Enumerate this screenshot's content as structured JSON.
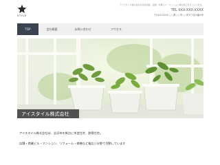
{
  "brand": {
    "logo_text": "STYLE"
  },
  "header": {
    "tagline": "アイスタイル株式会社は住宅建築、店舗・商業ビル・マンション等の施工を行っています。",
    "phone": "TEL 0XX-XXX-XXXX",
    "address": "〒XXX-XXXX ○○県○○市○○町X丁目X番X号"
  },
  "nav": {
    "items": [
      {
        "label": "TOP"
      },
      {
        "label": "会社概要"
      },
      {
        "label": "お問い合わせ"
      },
      {
        "label": "アクセス"
      }
    ]
  },
  "hero": {
    "company_name": "アイスタイル株式会社"
  },
  "intro": {
    "line1": "アイスタイル株式会社は、全沢市を拠点に木造住宅、鉄骨住宅。",
    "line2": "店舗・商業ビル・マンション、リフォーム・修繕など幅広い分野で活動しています"
  },
  "colors": {
    "nav_active": "#3a4350",
    "nav_bg": "#efefef"
  }
}
